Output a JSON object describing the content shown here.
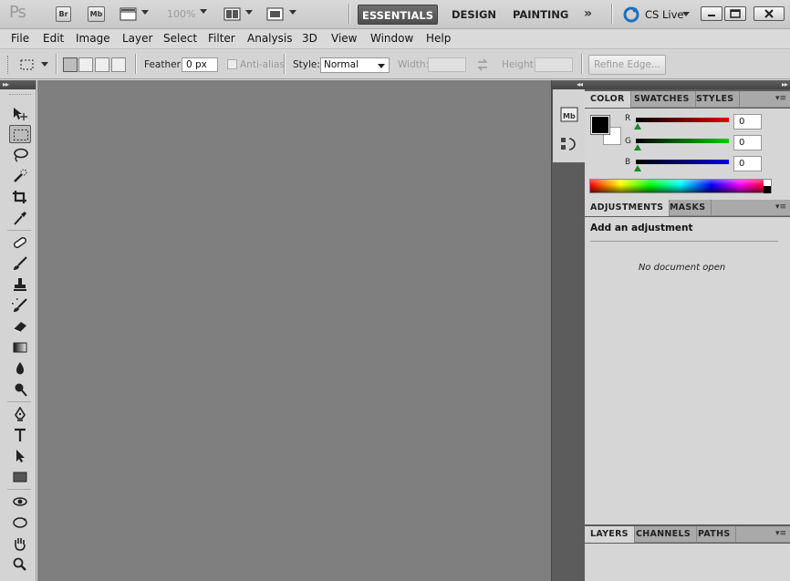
{
  "app": {
    "logo": "Ps",
    "bridge_btn": "Br",
    "minibridge_btn": "Mb",
    "zoom_level": "100%",
    "workspaces": [
      "ESSENTIALS",
      "DESIGN",
      "PAINTING"
    ],
    "active_workspace": "ESSENTIALS",
    "more_workspaces": "»",
    "cs_live": "CS Live"
  },
  "menu": [
    "File",
    "Edit",
    "Image",
    "Layer",
    "Select",
    "Filter",
    "Analysis",
    "3D",
    "View",
    "Window",
    "Help"
  ],
  "options": {
    "feather_label": "Feather:",
    "feather_value": "0 px",
    "antialias_label": "Anti-alias",
    "style_label": "Style:",
    "style_value": "Normal",
    "width_label": "Width:",
    "height_label": "Height:",
    "refine_edge": "Refine Edge..."
  },
  "panels": {
    "color": {
      "tabs": [
        "COLOR",
        "SWATCHES",
        "STYLES"
      ],
      "channels": [
        {
          "name": "R",
          "value": "0",
          "color": "#e00000"
        },
        {
          "name": "G",
          "value": "0",
          "color": "#00d000"
        },
        {
          "name": "B",
          "value": "0",
          "color": "#0000e0"
        }
      ],
      "foreground": "#000000",
      "background": "#ffffff"
    },
    "adjustments": {
      "tabs": [
        "ADJUSTMENTS",
        "MASKS"
      ],
      "title": "Add an adjustment",
      "empty_text": "No document open"
    },
    "layers": {
      "tabs": [
        "LAYERS",
        "CHANNELS",
        "PATHS"
      ]
    }
  },
  "tools": [
    "move-tool",
    "rectangular-marquee-tool",
    "lasso-tool",
    "quick-selection-tool",
    "crop-tool",
    "eyedropper-tool",
    "spot-healing-brush-tool",
    "brush-tool",
    "clone-stamp-tool",
    "history-brush-tool",
    "eraser-tool",
    "gradient-tool",
    "blur-tool",
    "dodge-tool",
    "pen-tool",
    "type-tool",
    "path-selection-tool",
    "rectangle-tool",
    "3d-rotate-tool",
    "3d-orbit-tool",
    "hand-tool",
    "zoom-tool"
  ]
}
